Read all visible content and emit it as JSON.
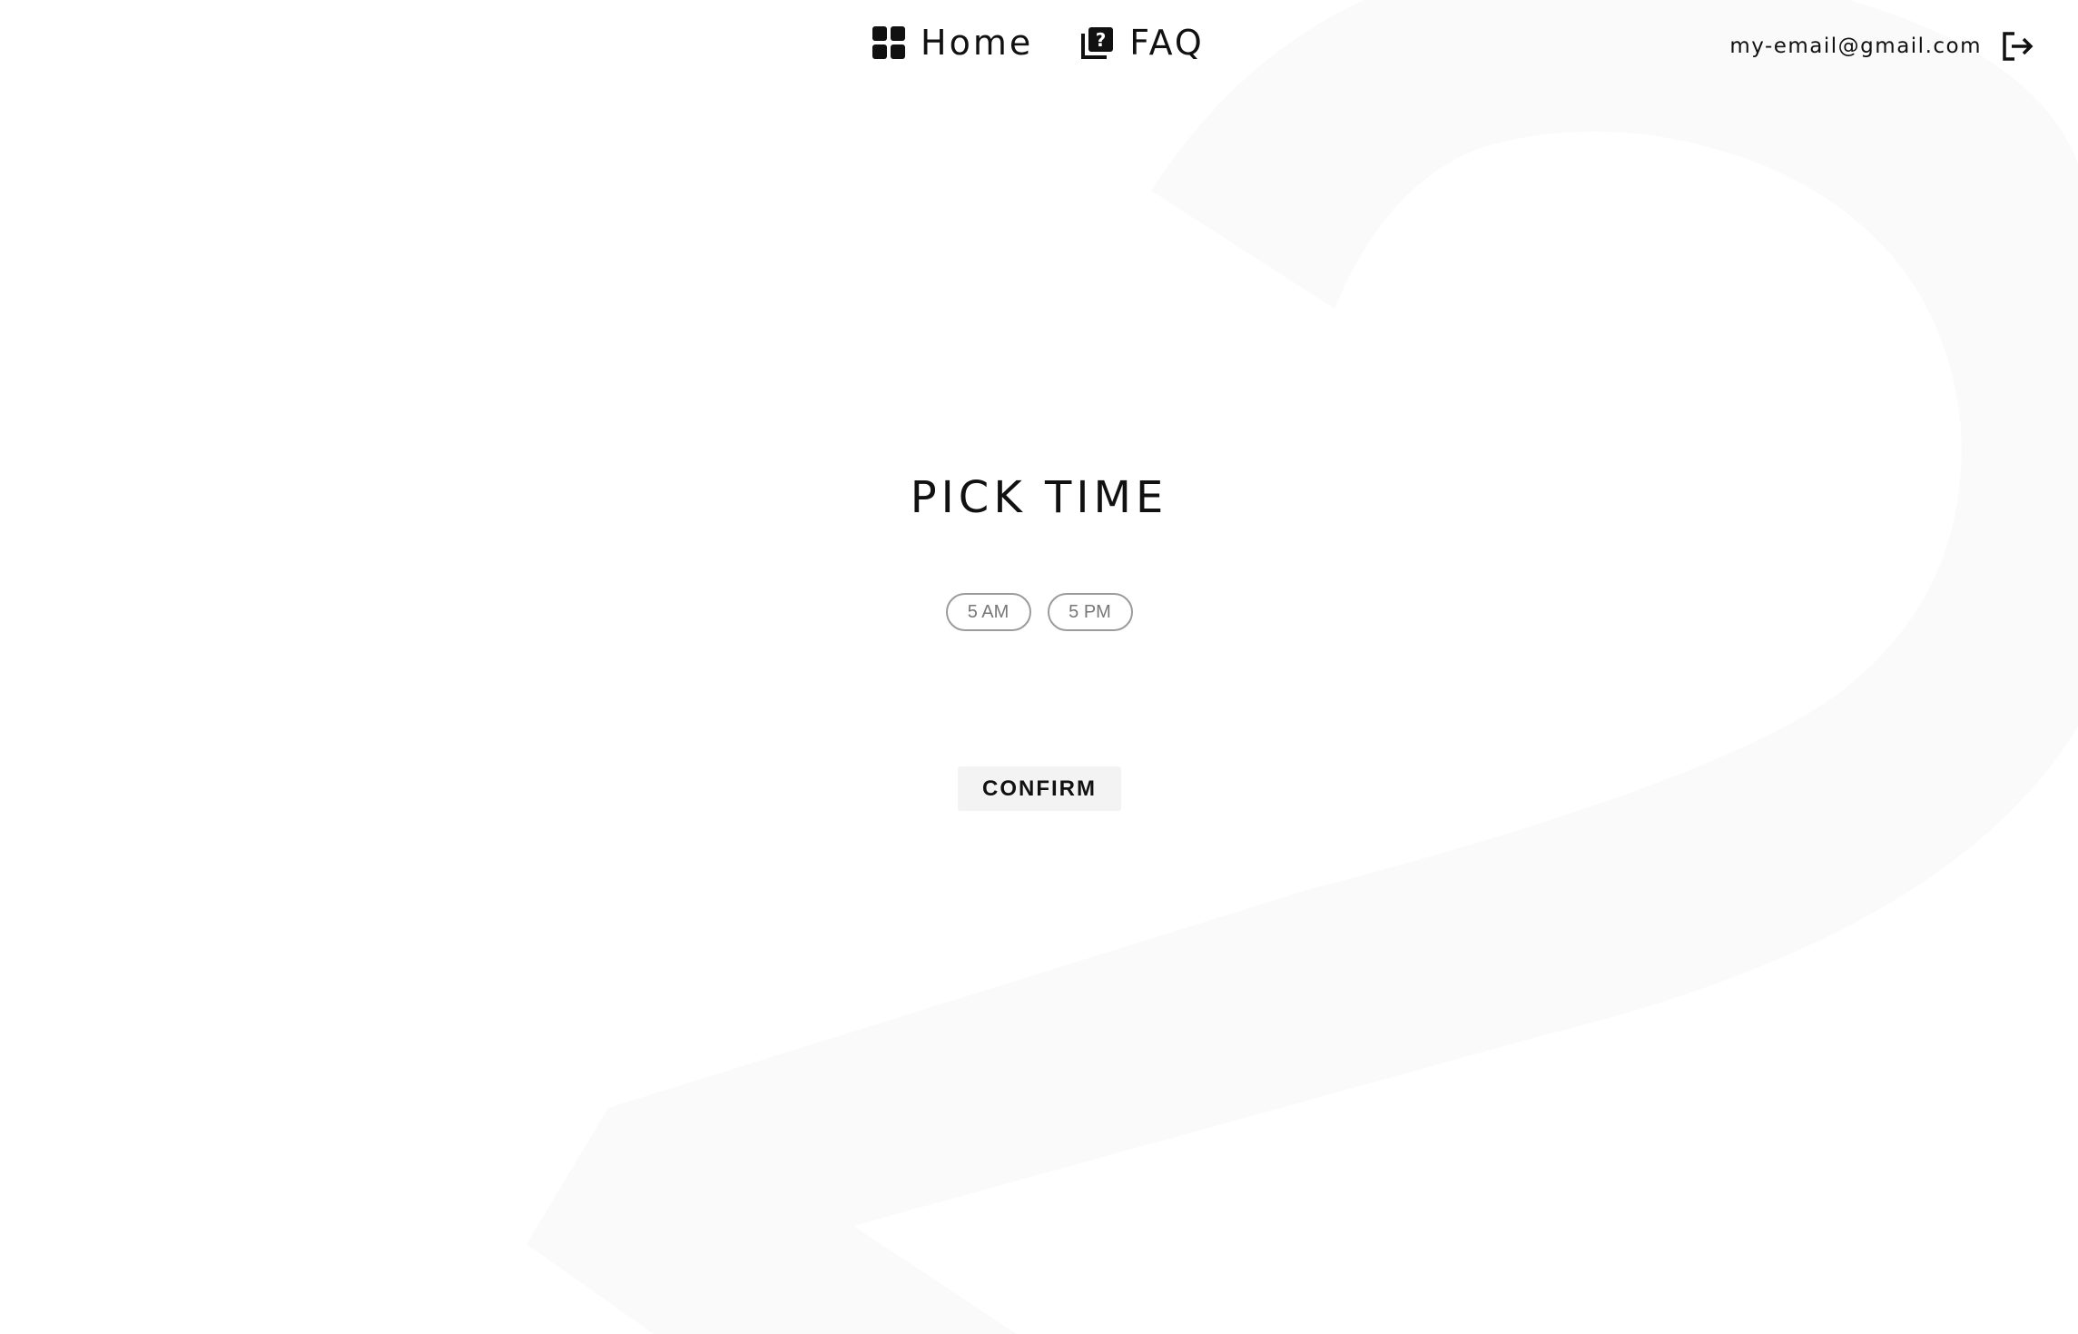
{
  "nav": {
    "items": [
      {
        "label": "Home",
        "icon": "dashboard-grid-icon"
      },
      {
        "label": "FAQ",
        "icon": "help-library-icon"
      }
    ]
  },
  "account": {
    "email": "my-email@gmail.com",
    "logout_icon": "logout-icon"
  },
  "main": {
    "title": "PICK TIME",
    "time_options": [
      "5 AM",
      "5 PM"
    ],
    "confirm_label": "CONFIRM"
  },
  "colors": {
    "text": "#111111",
    "chip_border": "#9b9b9b",
    "chip_text": "#777777",
    "button_bg": "#f3f3f3",
    "watermark": "#fafafa"
  }
}
